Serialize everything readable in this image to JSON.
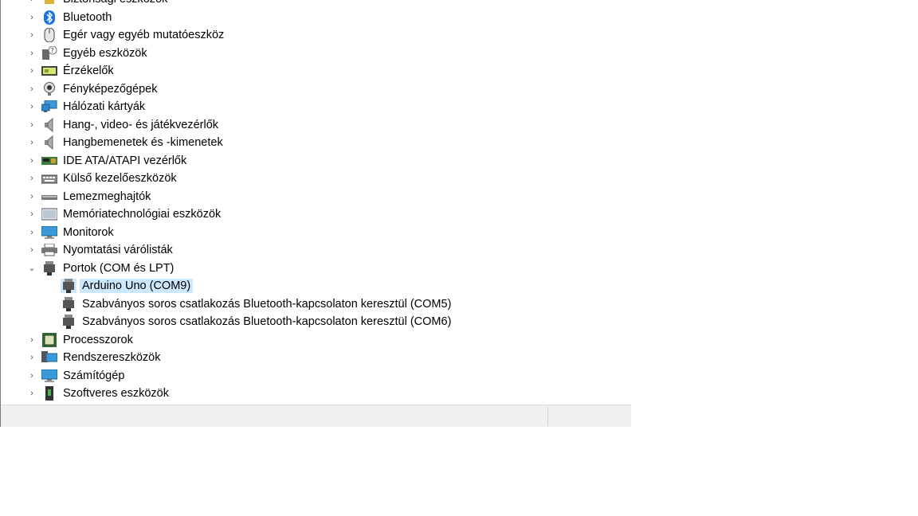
{
  "device_manager": {
    "categories_above": [
      {
        "label": "Biztonsági eszközök",
        "icon": "security-device-icon",
        "expanded": false
      },
      {
        "label": "Bluetooth",
        "icon": "bluetooth-icon",
        "expanded": false
      },
      {
        "label": "Egér vagy egyéb mutatóeszköz",
        "icon": "mouse-icon",
        "expanded": false
      },
      {
        "label": "Egyéb eszközök",
        "icon": "unknown-device-icon",
        "expanded": false
      },
      {
        "label": "Érzékelők",
        "icon": "sensor-icon",
        "expanded": false
      },
      {
        "label": "Fényképezőgépek",
        "icon": "camera-icon",
        "expanded": false
      },
      {
        "label": "Hálózati kártyák",
        "icon": "network-adapter-icon",
        "expanded": false
      },
      {
        "label": "Hang-, video- és játékvezérlők",
        "icon": "speaker-icon",
        "expanded": false
      },
      {
        "label": "Hangbemenetek és -kimenetek",
        "icon": "speaker-icon",
        "expanded": false
      },
      {
        "label": "IDE ATA/ATAPI vezérlők",
        "icon": "ide-controller-icon",
        "expanded": false
      },
      {
        "label": "Külső kezelőeszközök",
        "icon": "keyboard-device-icon",
        "expanded": false
      },
      {
        "label": "Lemezmeghajtók",
        "icon": "disk-drive-icon",
        "expanded": false
      },
      {
        "label": "Memóriatechnológiai eszközök",
        "icon": "memory-device-icon",
        "expanded": false
      },
      {
        "label": "Monitorok",
        "icon": "monitor-icon",
        "expanded": false
      },
      {
        "label": "Nyomtatási várólisták",
        "icon": "printer-icon",
        "expanded": false
      }
    ],
    "ports": {
      "label": "Portok (COM és LPT)",
      "icon": "port-icon",
      "expanded": true,
      "children": [
        {
          "label": "Arduino Uno (COM9)",
          "icon": "port-icon",
          "selected": true
        },
        {
          "label": "Szabványos soros csatlakozás Bluetooth-kapcsolaton keresztül (COM5)",
          "icon": "port-icon",
          "selected": false
        },
        {
          "label": "Szabványos soros csatlakozás Bluetooth-kapcsolaton keresztül (COM6)",
          "icon": "port-icon",
          "selected": false
        }
      ]
    },
    "categories_below": [
      {
        "label": "Processzorok",
        "icon": "processor-icon",
        "expanded": false
      },
      {
        "label": "Rendszereszközök",
        "icon": "system-device-icon",
        "expanded": false
      },
      {
        "label": "Számítógép",
        "icon": "computer-icon",
        "expanded": false
      },
      {
        "label": "Szoftveres eszközök",
        "icon": "software-device-icon",
        "expanded": false
      }
    ]
  },
  "colors": {
    "selection": "#cce8ff",
    "statusbar": "#f0f0f0",
    "bluetooth": "#1a73e8",
    "monitor": "#3a9ad9"
  }
}
